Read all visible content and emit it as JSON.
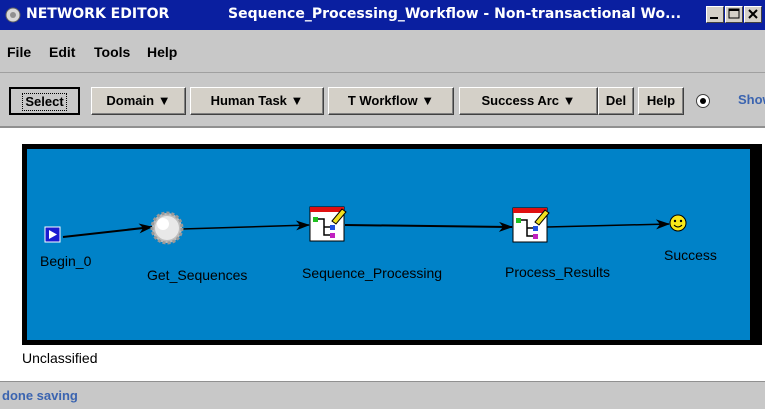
{
  "window": {
    "app_title": "NETWORK EDITOR",
    "doc_title": "Sequence_Processing_Workflow - Non-transactional Wo..."
  },
  "menu": {
    "file": "File",
    "edit": "Edit",
    "tools": "Tools",
    "help": "Help"
  },
  "toolbar": {
    "select": "Select",
    "domain": "Domain ▼",
    "human_task": "Human Task ▼",
    "t_workflow": "T Workflow ▼",
    "success_arc": "Success Arc ▼",
    "del": "Del",
    "help": "Help",
    "show": "Show"
  },
  "workflow": {
    "nodes": [
      {
        "label": "Begin_0",
        "icon": "start-flag-icon"
      },
      {
        "label": "Get_Sequences",
        "icon": "gear-sphere-icon"
      },
      {
        "label": "Sequence_Processing",
        "icon": "subworkflow-icon"
      },
      {
        "label": "Process_Results",
        "icon": "subworkflow-icon"
      },
      {
        "label": "Success",
        "icon": "smiley-icon"
      }
    ],
    "canvas_color": "#0082c8",
    "category": "Unclassified"
  },
  "status": {
    "text": "done saving"
  }
}
